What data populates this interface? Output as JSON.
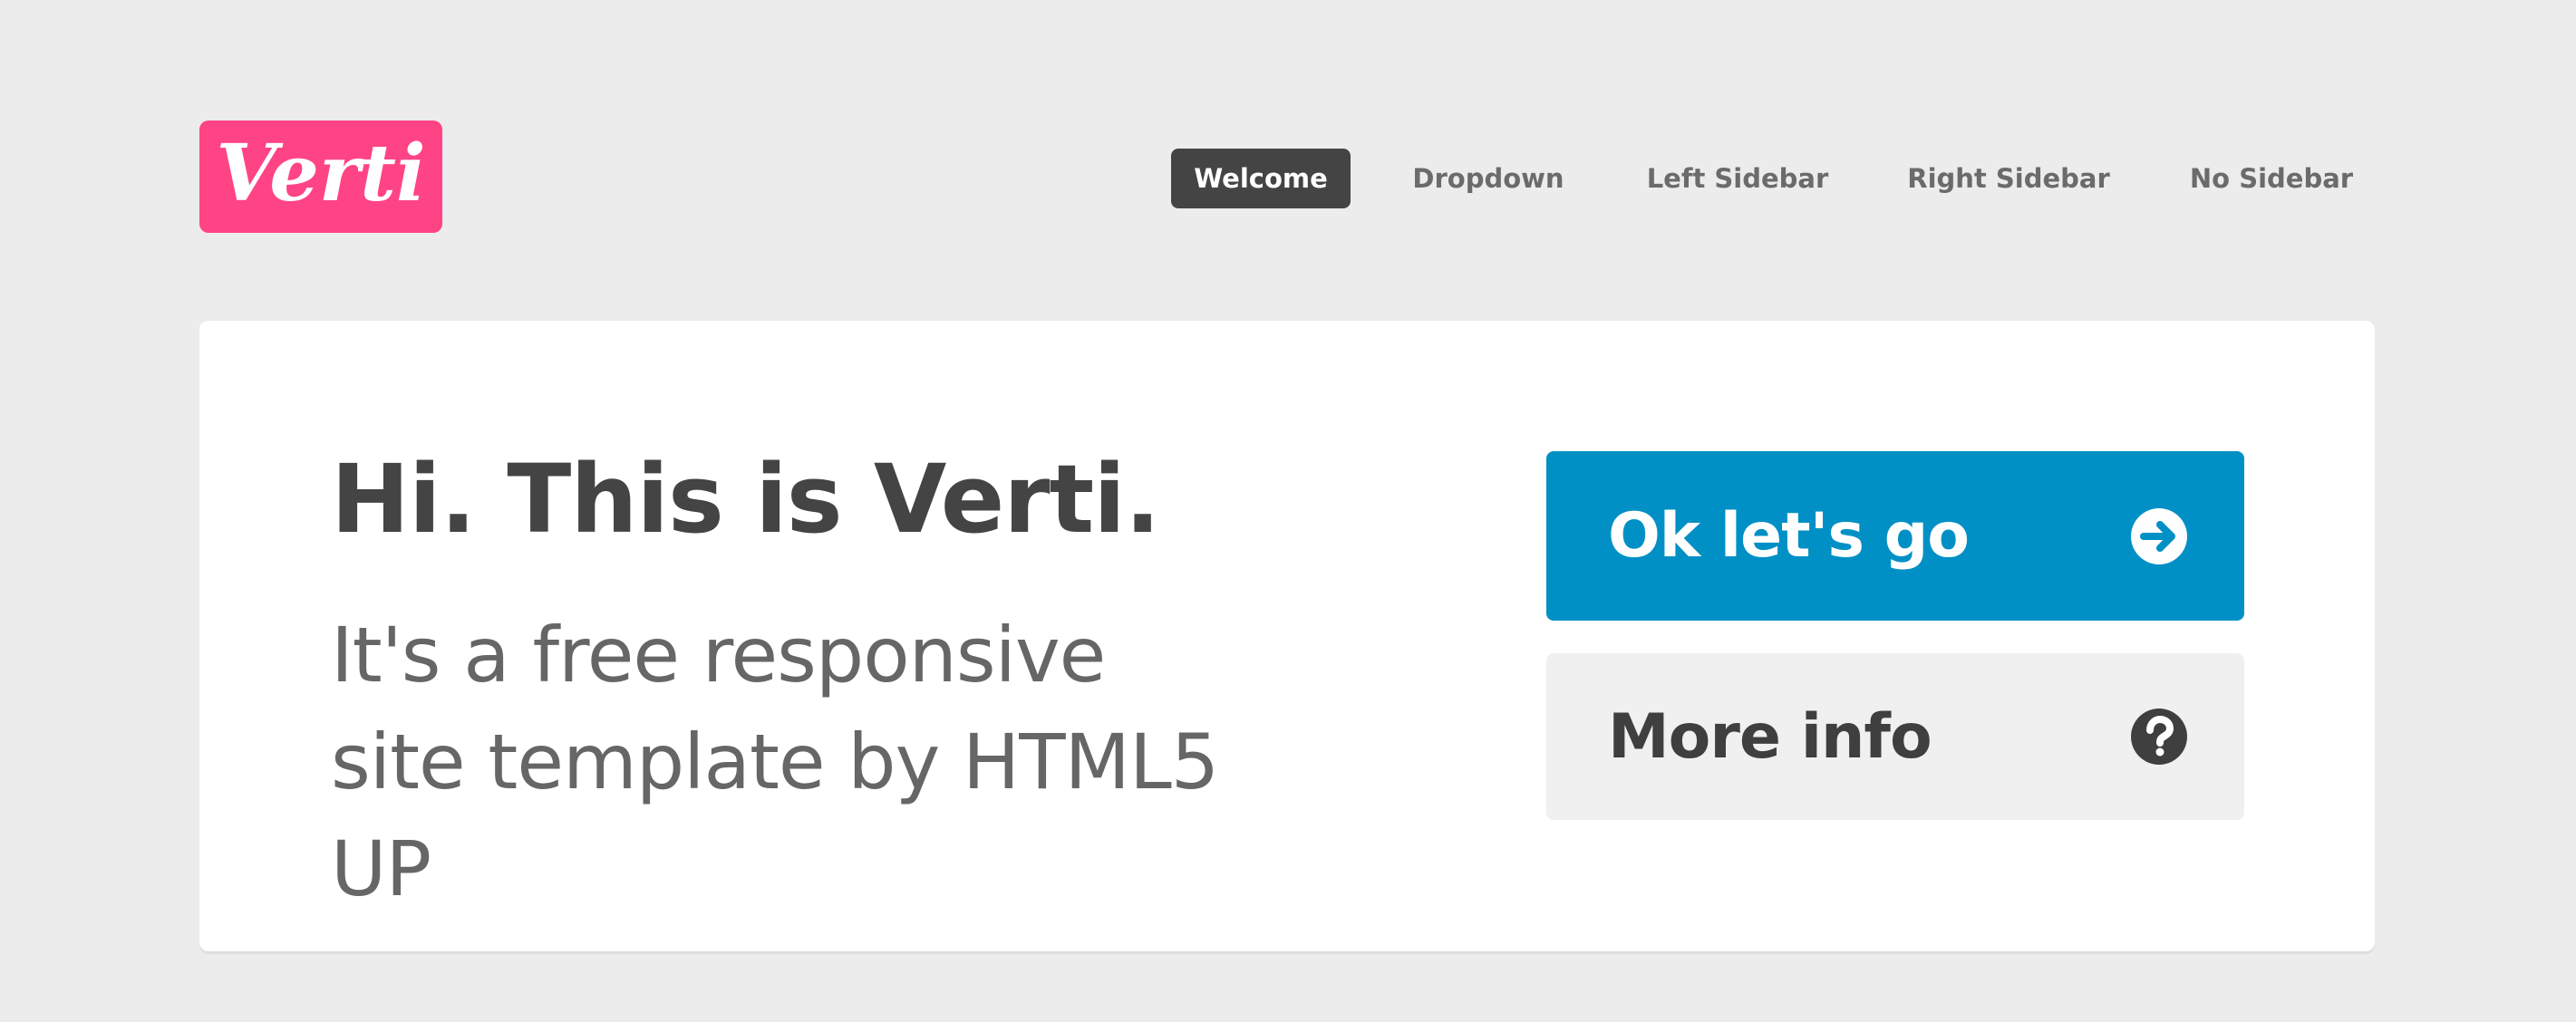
{
  "brand": {
    "logo_text": "Verti",
    "logo_color": "#ff4486"
  },
  "nav": {
    "active": "Welcome",
    "items": [
      {
        "label": "Welcome"
      },
      {
        "label": "Dropdown"
      },
      {
        "label": "Left Sidebar"
      },
      {
        "label": "Right Sidebar"
      },
      {
        "label": "No Sidebar"
      }
    ]
  },
  "banner": {
    "headline": "Hi. This is Verti.",
    "subline": "It's a free responsive site template by HTML5 UP",
    "buttons": {
      "primary": {
        "label": "Ok let's go",
        "icon": "arrow-circle-right-icon",
        "color": "#0090c5"
      },
      "secondary": {
        "label": "More info",
        "icon": "question-circle-icon",
        "color": "#f0f0f0"
      }
    }
  },
  "colors": {
    "background": "#ececec",
    "text_dark": "#444444",
    "nav_active_bg": "#444444"
  }
}
